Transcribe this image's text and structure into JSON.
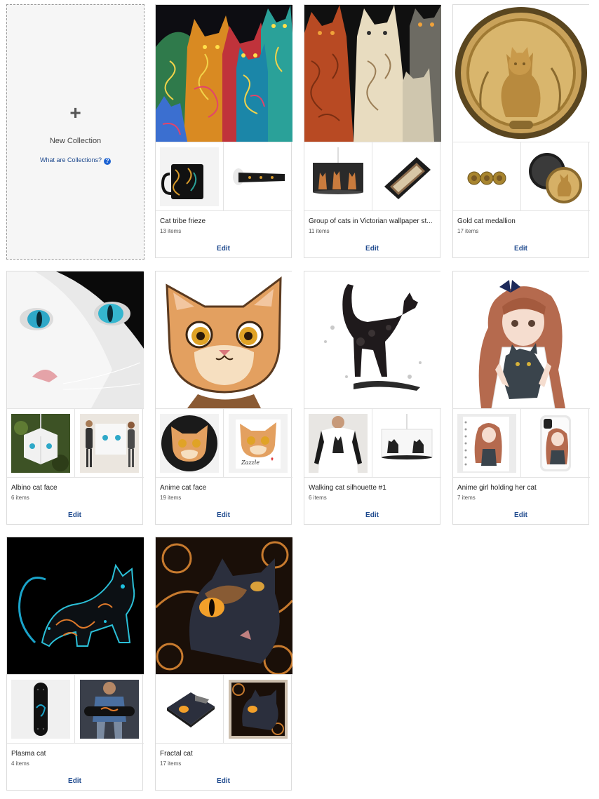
{
  "new_collection": {
    "plus": "+",
    "label": "New Collection",
    "help_link": "What are Collections?",
    "help_icon": "?"
  },
  "collections": [
    {
      "title": "Cat tribe frieze",
      "count": "13 items",
      "edit": "Edit",
      "cover": "cat-tribe-art",
      "thumbs": [
        "mug",
        "ribbon"
      ]
    },
    {
      "title": "Group of cats in Victorian wallpaper st...",
      "count": "11 items",
      "edit": "Edit",
      "cover": "victorian-cats-art",
      "thumbs": [
        "pendant-lamp",
        "phone-wallet-case"
      ]
    },
    {
      "title": "Gold cat medallion",
      "count": "17 items",
      "edit": "Edit",
      "cover": "gold-medallion-art",
      "thumbs": [
        "cufflinks",
        "magnet"
      ]
    },
    {
      "title": "Albino cat face",
      "count": "6 items",
      "edit": "Edit",
      "cover": "albino-cat-art",
      "thumbs": [
        "cube-ornament",
        "poster"
      ]
    },
    {
      "title": "Anime cat face",
      "count": "19 items",
      "edit": "Edit",
      "cover": "anime-cat-art",
      "thumbs": [
        "round-sticker",
        "square-sticker"
      ]
    },
    {
      "title": "Walking cat silhouette #1",
      "count": "6 items",
      "edit": "Edit",
      "cover": "cat-silhouette-art",
      "thumbs": [
        "raglan-shirt",
        "pendant-lamp"
      ]
    },
    {
      "title": "Anime girl holding her cat",
      "count": "7 items",
      "edit": "Edit",
      "cover": "anime-girl-art",
      "thumbs": [
        "notebook",
        "phone-case"
      ]
    },
    {
      "title": "Plasma cat",
      "count": "4 items",
      "edit": "Edit",
      "cover": "plasma-cat-art",
      "thumbs": [
        "skateboard",
        "skateboard-model"
      ]
    },
    {
      "title": "Fractal cat",
      "count": "17 items",
      "edit": "Edit",
      "cover": "fractal-cat-art",
      "thumbs": [
        "mouse-pad",
        "framed-print"
      ]
    }
  ],
  "sticker_text": "Zazzle"
}
